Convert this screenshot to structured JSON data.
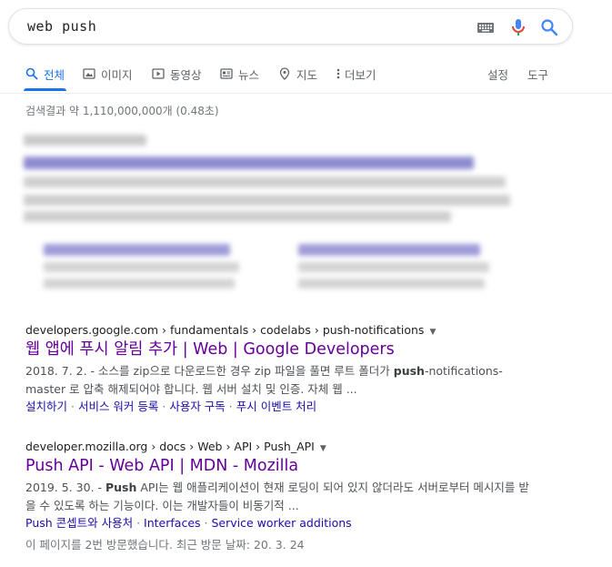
{
  "search": {
    "query": "web push"
  },
  "tabs": [
    {
      "label": "전체",
      "icon": "search-icon"
    },
    {
      "label": "이미지",
      "icon": "image-icon"
    },
    {
      "label": "동영상",
      "icon": "video-icon"
    },
    {
      "label": "뉴스",
      "icon": "news-icon"
    },
    {
      "label": "지도",
      "icon": "map-pin-icon"
    },
    {
      "label": "더보기",
      "icon": "more-vert-icon"
    }
  ],
  "tools": {
    "settings": "설정",
    "tools": "도구"
  },
  "stats": "검색결과 약 1,110,000,000개 (0.48초)",
  "results": [
    {
      "cite": "developers.google.com › fundamentals › codelabs › push-notifications",
      "title": "웹 앱에 푸시 알림 추가 | Web | Google Developers",
      "snippet_pre": "2018. 7. 2. - 소스를 zip으로 다운로드한 경우 zip 파일을 풀면 루트 폴더가 ",
      "snippet_bold": "push",
      "snippet_post": "-notifications-master 로 압축 해제되어야 합니다. 웹 서버 설치 및 인증. 자체 웹 ...",
      "sitelinks": [
        "설치하기",
        "서비스 워커 등록",
        "사용자 구독",
        "푸시 이벤트 처리"
      ]
    },
    {
      "cite": "developer.mozilla.org › docs › Web › API › Push_API",
      "title": "Push API - Web API | MDN - Mozilla",
      "snippet_pre": "2019. 5. 30. - ",
      "snippet_bold": "Push",
      "snippet_post": " API는 웹 애플리케이션이 현재 로딩이 되어 있지 않더라도 서버로부터 메시지를 받을 수 있도록 하는 기능이다. 이는 개발자들이 비동기적 ...",
      "sitelinks": [
        "Push 콘셉트와 사용처",
        "Interfaces",
        "Service worker additions"
      ],
      "visited": "이 페이지를 2번 방문했습니다. 최근 방문 날짜: 20. 3. 24"
    }
  ],
  "colors": {
    "accent": "#1a73e8",
    "visited_title": "#660099",
    "link": "#1a0dab"
  }
}
